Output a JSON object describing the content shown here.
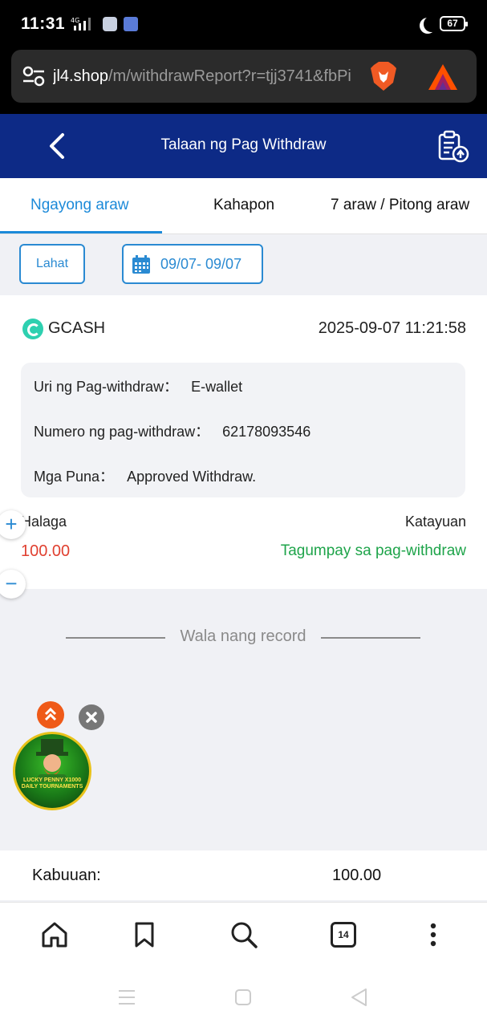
{
  "status_bar": {
    "time": "11:31",
    "network": "4G",
    "battery": "67"
  },
  "browser": {
    "url_domain": "jl4.shop",
    "url_path": "/m/withdrawReport?r=tjj3741&fbPi",
    "tabs_count": "14"
  },
  "header": {
    "title": "Talaan ng Pag Withdraw"
  },
  "tabs": [
    {
      "label": "Ngayong araw",
      "active": true
    },
    {
      "label": "Kahapon",
      "active": false
    },
    {
      "label": "7 araw / Pitong araw",
      "active": false
    }
  ],
  "filters": {
    "all_label": "Lahat",
    "date_range": "09/07- 09/07"
  },
  "record": {
    "method": "GCASH",
    "datetime": "2025-09-07 11:21:58",
    "type_label": "Uri ng Pag-withdraw：",
    "type_value": "E-wallet",
    "number_label": "Numero ng pag-withdraw：",
    "number_value": "62178093546",
    "remarks_label": "Mga Puna：",
    "remarks_value": "Approved Withdraw.",
    "amount_label": "Halaga",
    "amount_value": "100.00",
    "status_label": "Katayuan",
    "status_value": "Tagumpay sa pag-withdraw"
  },
  "zoom": {
    "plus": "+",
    "minus": "−"
  },
  "no_record_text": "Wala nang record",
  "promo": {
    "text": "LUCKY PENNY X1000 DAILY TOURNAMENTS"
  },
  "total": {
    "label": "Kabuuan:",
    "value": "100.00"
  },
  "colors": {
    "header_bg": "#0d2a86",
    "accent": "#1c8ad9",
    "amount": "#e04030",
    "success": "#1ea44a"
  }
}
